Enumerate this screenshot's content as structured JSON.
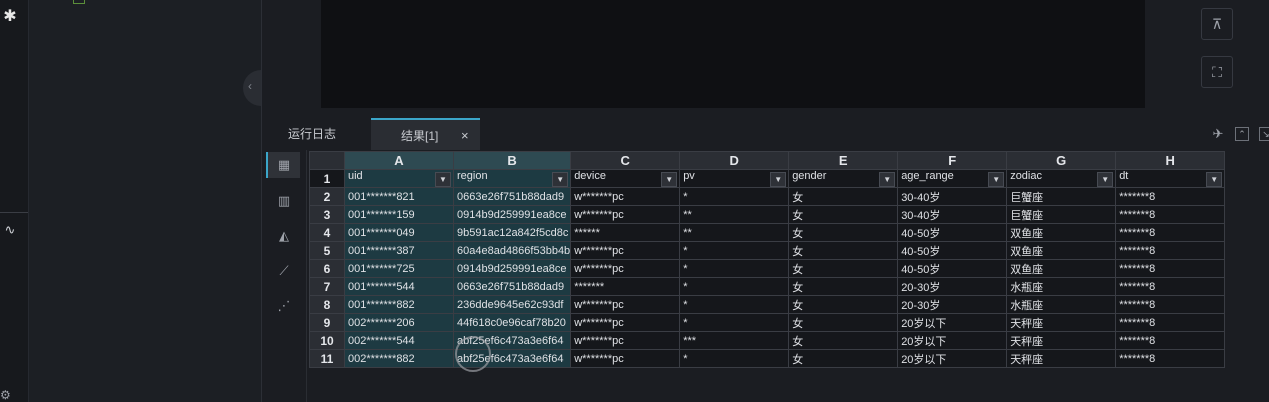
{
  "left_rail": {
    "icons": [
      "puzzle-icon",
      "waveform-icon",
      "settings-icon"
    ]
  },
  "toolbar": {
    "scroll_top": "⊼",
    "fullscreen": "⛶"
  },
  "tabs": [
    {
      "label": "运行日志"
    },
    {
      "label": "结果[1]",
      "close": "×",
      "active": true
    }
  ],
  "right_tools": [
    "pin-icon",
    "collapse-icon",
    "export-icon"
  ],
  "views": [
    "table-view-icon",
    "bar-chart-icon",
    "area-chart-icon",
    "line-chart-icon",
    "scatter-chart-icon"
  ],
  "grid": {
    "columns": [
      "A",
      "B",
      "C",
      "D",
      "E",
      "F",
      "G",
      "H"
    ],
    "header_row": {
      "num": "1",
      "fields": [
        "uid",
        "region",
        "device",
        "pv",
        "gender",
        "age_range",
        "zodiac",
        "dt"
      ]
    },
    "rows": [
      {
        "num": "2",
        "cells": [
          "001*******821",
          "0663e26f751b88dad9",
          "w*******pc",
          "*",
          "女",
          "30-40岁",
          "巨蟹座",
          "*******8"
        ]
      },
      {
        "num": "3",
        "cells": [
          "001*******159",
          "0914b9d259991ea8ce",
          "w*******pc",
          "**",
          "女",
          "30-40岁",
          "巨蟹座",
          "*******8"
        ]
      },
      {
        "num": "4",
        "cells": [
          "001*******049",
          "9b591ac12a842f5cd8c",
          "******",
          "**",
          "女",
          "40-50岁",
          "双鱼座",
          "*******8"
        ]
      },
      {
        "num": "5",
        "cells": [
          "001*******387",
          "60a4e8ad4866f53bb4b",
          "w*******pc",
          "*",
          "女",
          "40-50岁",
          "双鱼座",
          "*******8"
        ]
      },
      {
        "num": "6",
        "cells": [
          "001*******725",
          "0914b9d259991ea8ce",
          "w*******pc",
          "*",
          "女",
          "40-50岁",
          "双鱼座",
          "*******8"
        ]
      },
      {
        "num": "7",
        "cells": [
          "001*******544",
          "0663e26f751b88dad9",
          "*******",
          "*",
          "女",
          "20-30岁",
          "水瓶座",
          "*******8"
        ]
      },
      {
        "num": "8",
        "cells": [
          "001*******882",
          "236dde9645e62c93df",
          "w*******pc",
          "*",
          "女",
          "20-30岁",
          "水瓶座",
          "*******8"
        ]
      },
      {
        "num": "9",
        "cells": [
          "002*******206",
          "44f618c0e96caf78b20",
          "w*******pc",
          "*",
          "女",
          "20岁以下",
          "天秤座",
          "*******8"
        ]
      },
      {
        "num": "10",
        "cells": [
          "002*******544",
          "abf25ef6c473a3e6f64",
          "w*******pc",
          "***",
          "女",
          "20岁以下",
          "天秤座",
          "*******8"
        ]
      },
      {
        "num": "11",
        "cells": [
          "002*******882",
          "abf25ef6c473a3e6f64",
          "w*******pc",
          "*",
          "女",
          "20岁以下",
          "天秤座",
          "*******8"
        ]
      }
    ]
  },
  "colors": {
    "accent": "#3ba6c9",
    "background": "#1b1d22"
  }
}
